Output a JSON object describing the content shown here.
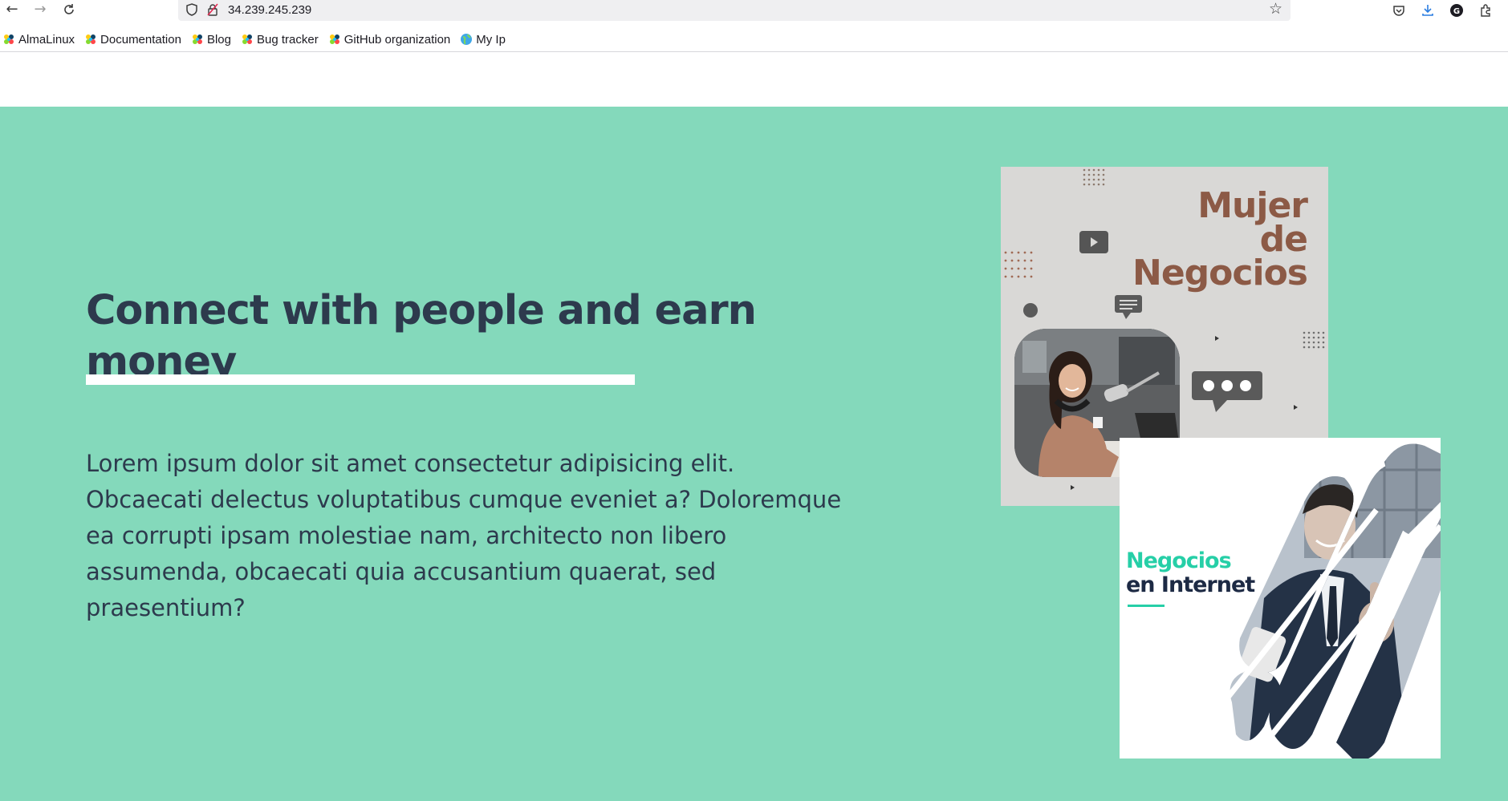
{
  "browser": {
    "url": "34.239.245.239",
    "bookmarks": [
      {
        "label": "AlmaLinux"
      },
      {
        "label": "Documentation"
      },
      {
        "label": "Blog"
      },
      {
        "label": "Bug tracker"
      },
      {
        "label": "GitHub organization"
      },
      {
        "label": "My Ip"
      }
    ]
  },
  "hero": {
    "title": "Connect with people and earn money",
    "body": "Lorem ipsum dolor sit amet consectetur adipisicing elit. Obcaecati delectus voluptatibus cumque eveniet a? Doloremque ea corrupti ipsam molestiae nam, architecto non libero assumenda, obcaecati quia accusantium quaerat, sed praesentium?"
  },
  "card1": {
    "title_lines": [
      "Mujer",
      "de",
      "Negocios"
    ]
  },
  "card2": {
    "title_line1": "Negocios",
    "title_line2": "en Internet"
  },
  "colors": {
    "hero_bg": "#84d9bb",
    "heading": "#2d3a4d",
    "card1_title": "#8c5a46",
    "card2_accent": "#26cfa7",
    "card2_dark": "#1d2a44"
  }
}
